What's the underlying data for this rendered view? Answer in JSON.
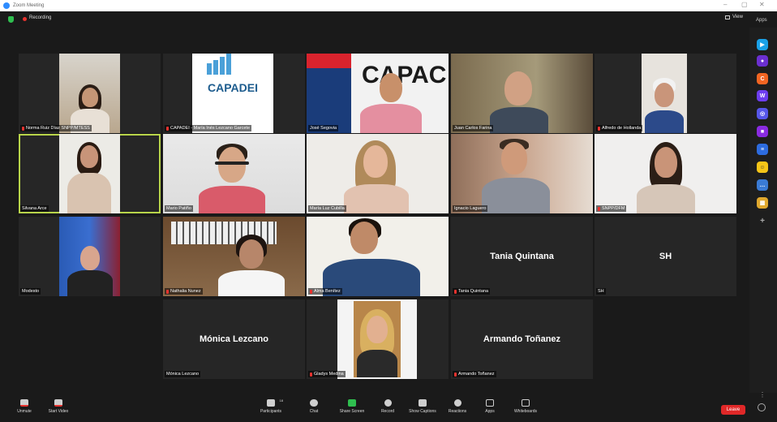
{
  "window": {
    "title": "Zoom Meeting",
    "minimize": "–",
    "maximize": "▢",
    "close": "✕"
  },
  "topbar": {
    "recording_label": "Recording",
    "view_label": "View",
    "apps_label": "Apps"
  },
  "participants": [
    {
      "name": "Norma Ruiz Díaz SNPP/MTESS",
      "muted": true
    },
    {
      "name": "CAPADEI - María Inés Lezcano Garcete",
      "muted": true,
      "logo_text": "CAPADEI"
    },
    {
      "name": "José Segovia",
      "muted": false,
      "banner_text": "CAPAC"
    },
    {
      "name": "Juan Carlos Farina",
      "muted": false
    },
    {
      "name": "Alfredo de Hollanda",
      "muted": true
    },
    {
      "name": "Silvana Arce",
      "muted": false
    },
    {
      "name": "Mario Patiño",
      "muted": false
    },
    {
      "name": "María Luz Cubilla",
      "muted": false
    },
    {
      "name": "Ignacio Laguero",
      "muted": false
    },
    {
      "name": "SNPP/DFM",
      "muted": true
    },
    {
      "name": "Modesto",
      "muted": false
    },
    {
      "name": "Nathalia Nunez",
      "muted": true
    },
    {
      "name": "Alma Benítez",
      "muted": true
    },
    {
      "name": "Tania Quintana",
      "muted": true,
      "display_name": "Tania Quintana"
    },
    {
      "name": "SH",
      "muted": false,
      "display_name": "SH"
    },
    {
      "name": "Mónica Lezcano",
      "muted": false,
      "display_name": "Mónica Lezcano"
    },
    {
      "name": "Gladys Medina",
      "muted": true
    },
    {
      "name": "Armando Toñanez",
      "muted": true,
      "display_name": "Armando Toñanez"
    }
  ],
  "toolbar": {
    "unmute": "Unmute",
    "start_video": "Start Video",
    "participants": "Participants",
    "participants_count": "18",
    "chat": "Chat",
    "share_screen": "Share Screen",
    "record": "Record",
    "show_captions": "Show Captions",
    "reactions": "Reactions",
    "apps": "Apps",
    "whiteboards": "Whiteboards",
    "leave": "Leave"
  },
  "colors": {
    "active_speaker": "#b8d44a",
    "share_green": "#2fbf4f",
    "leave_red": "#e02828"
  }
}
